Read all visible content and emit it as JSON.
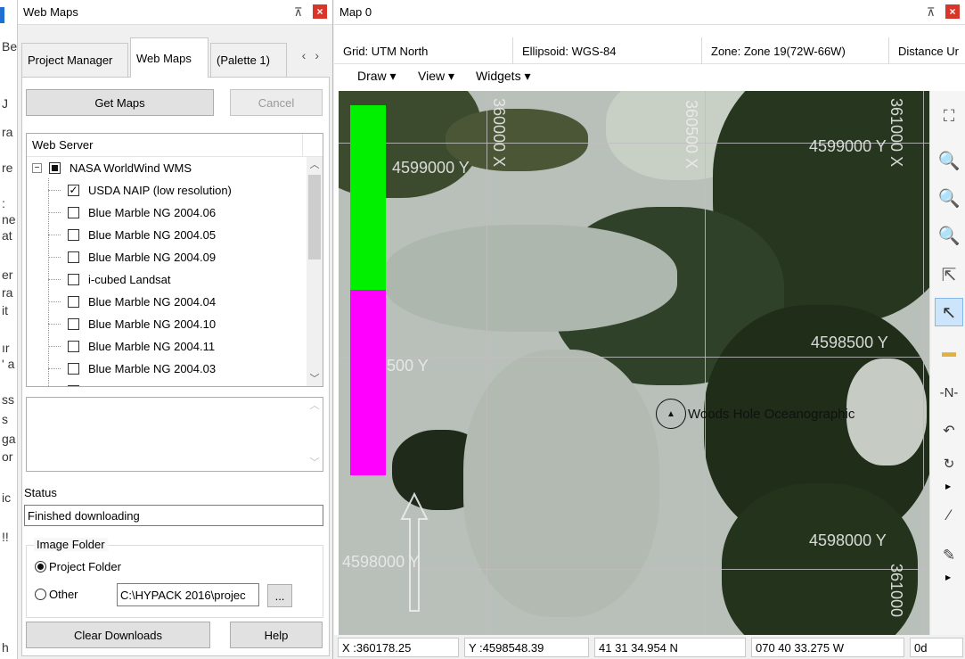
{
  "peek": {
    "chars": [
      "Be",
      "J",
      "ra",
      "re",
      ":",
      "ne",
      "at",
      "er",
      "ra",
      "it",
      "ır",
      "' a",
      "ss",
      "s",
      "ga",
      "or",
      "ic",
      "!!",
      "h"
    ]
  },
  "web_maps_panel": {
    "title": "Web Maps",
    "tabs": [
      {
        "label": "Project Manager"
      },
      {
        "label": "Web Maps"
      },
      {
        "label": "(Palette 1)"
      }
    ],
    "get_maps_label": "Get Maps",
    "cancel_label": "Cancel",
    "tree_header": "Web Server",
    "server_name": "NASA WorldWind WMS",
    "layers": [
      {
        "name": "USDA NAIP (low resolution)",
        "checked": true
      },
      {
        "name": "Blue Marble NG 2004.06",
        "checked": false
      },
      {
        "name": "Blue Marble NG 2004.05",
        "checked": false
      },
      {
        "name": "Blue Marble NG 2004.09",
        "checked": false
      },
      {
        "name": "i-cubed Landsat",
        "checked": false
      },
      {
        "name": "Blue Marble NG 2004.04",
        "checked": false
      },
      {
        "name": "Blue Marble NG 2004.10",
        "checked": false
      },
      {
        "name": "Blue Marble NG 2004.11",
        "checked": false
      },
      {
        "name": "Blue Marble NG 2004.03",
        "checked": false
      }
    ],
    "status_label": "Status",
    "status_value": "Finished downloading",
    "image_folder_label": "Image Folder",
    "project_folder_label": "Project Folder",
    "other_label": "Other",
    "other_path": "C:\\HYPACK 2016\\projec",
    "browse_label": "...",
    "clear_downloads_label": "Clear Downloads",
    "help_label": "Help"
  },
  "map_panel": {
    "title": "Map 0",
    "grid": "Grid: UTM North",
    "ellipsoid": "Ellipsoid: WGS-84",
    "zone": "Zone: Zone 19(72W-66W)",
    "distance": "Distance Ur",
    "menus": [
      "Draw ▾",
      "View ▾",
      "Widgets ▾"
    ],
    "grid_labels": {
      "y_top_left": "4599000 Y",
      "y_top_right": "4599000 Y",
      "y_mid_left": "4598500 Y",
      "y_mid_right": "4598500 Y",
      "y_bot_left": "4598000 Y",
      "y_bot_right": "4598000 Y",
      "x_left": "360000 X",
      "x_mid": "360500 X",
      "x_right": "361000 X",
      "x_right_bottom": "361000"
    },
    "poi_label": "Woods Hole Oceanographic",
    "status": {
      "x": "X :360178.25",
      "y": "Y :4598548.39",
      "lat": "41 31 34.954 N",
      "lon": "070 40 33.275 W",
      "heading": "0d"
    }
  },
  "colors": {
    "green_bar": "#00f000",
    "magenta_bar": "#ff00ff",
    "close_red": "#d9362b"
  }
}
